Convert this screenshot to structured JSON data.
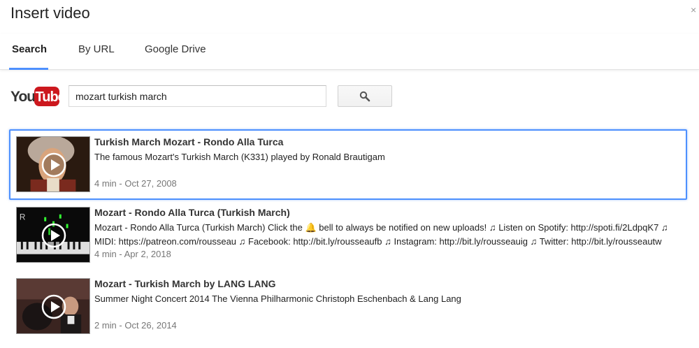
{
  "dialog": {
    "title": "Insert video",
    "close_glyph": "×"
  },
  "tabs": [
    {
      "label": "Search",
      "active": true
    },
    {
      "label": "By URL",
      "active": false
    },
    {
      "label": "Google Drive",
      "active": false
    }
  ],
  "logo": {
    "you": "You",
    "tube": "Tube",
    "brand_color": "#cc181e"
  },
  "search": {
    "value": "mozart turkish march",
    "button_icon": "search-icon"
  },
  "results": [
    {
      "title": "Turkish March Mozart - Rondo Alla Turca",
      "description": "The famous Mozart's Turkish March (K331) played by Ronald Brautigam",
      "meta": "4 min - Oct 27, 2008",
      "selected": true,
      "thumb_icon": "mozart-portrait"
    },
    {
      "title": "Mozart - Rondo Alla Turca (Turkish March)",
      "description": "Mozart - Rondo Alla Turca (Turkish March) Click the 🔔 bell to always be notified on new uploads! ♫ Listen on Spotify: http://spoti.fi/2LdpqK7 ♫ MIDI: https://patreon.com/rousseau ♫ Facebook: http://bit.ly/rousseaufb ♫ Instagram: http://bit.ly/rousseauig ♫ Twitter: http://bit.ly/rousseautw",
      "meta": "4 min - Apr 2, 2018",
      "selected": false,
      "thumb_icon": "piano-keys"
    },
    {
      "title": "Mozart - Turkish March by LANG LANG",
      "description": "Summer Night Concert 2014 The Vienna Philharmonic Christoph Eschenbach & Lang Lang",
      "meta": "2 min - Oct 26, 2014",
      "selected": false,
      "thumb_icon": "concert-stage"
    }
  ],
  "colors": {
    "accent": "#4d90fe",
    "meta_text": "#777777"
  }
}
